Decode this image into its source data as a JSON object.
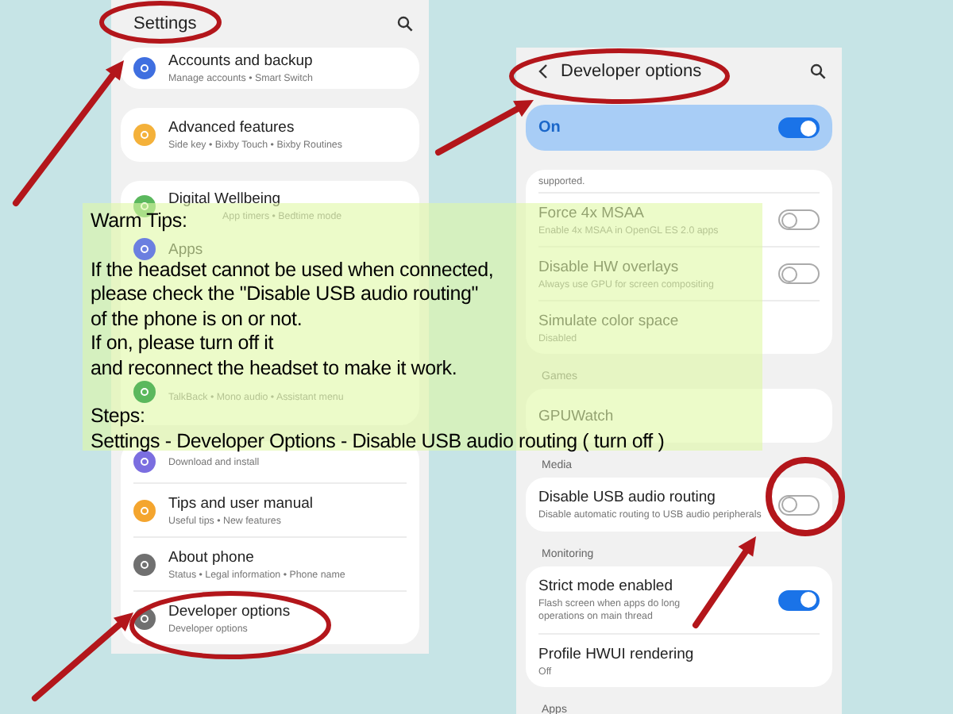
{
  "settings_screen": {
    "title": "Settings",
    "groups": [
      [
        {
          "title": "Accounts and backup",
          "subtitle": "Manage accounts • Smart Switch",
          "color": "#3f6fe0"
        }
      ],
      [
        {
          "title": "Advanced features",
          "subtitle": "Side key • Bixby Touch • Bixby Routines",
          "color": "#f4b13a"
        }
      ],
      [
        {
          "title": "Digital Wellbeing",
          "subtitle": "App timers • Bedtime mode",
          "color": "#5bb85d"
        },
        {
          "title": "Apps",
          "color": "#6b7fe0"
        },
        {
          "subtitle": "TalkBack • Mono audio • Assistant menu",
          "color": "#5bb85d"
        }
      ],
      [
        {
          "subtitle": "Download and install",
          "color": "#7b6ee0"
        },
        {
          "title": "Tips and user manual",
          "subtitle": "Useful tips • New features",
          "color": "#f4a52e"
        },
        {
          "title": "About phone",
          "subtitle": "Status • Legal information • Phone name",
          "color": "#707070"
        },
        {
          "title": "Developer options",
          "subtitle": "Developer options",
          "color": "#707070"
        }
      ]
    ]
  },
  "developer_screen": {
    "title": "Developer options",
    "master_switch": {
      "label": "On",
      "on": true
    },
    "sections": [
      {
        "items": [
          {
            "kind": "note",
            "subtitle": "supported."
          },
          {
            "kind": "toggle",
            "title": "Force 4x MSAA",
            "subtitle": "Enable 4x MSAA in OpenGL ES 2.0 apps",
            "on": false
          },
          {
            "kind": "toggle",
            "title": "Disable HW overlays",
            "subtitle": "Always use GPU for screen compositing",
            "on": false
          },
          {
            "kind": "plain",
            "title": "Simulate color space",
            "subtitle": "Disabled"
          }
        ]
      },
      {
        "heading": "Games",
        "items": [
          {
            "kind": "plain",
            "title": "GPUWatch"
          }
        ]
      },
      {
        "heading": "Media",
        "items": [
          {
            "kind": "toggle",
            "title": "Disable USB audio routing",
            "subtitle": "Disable automatic routing to USB audio peripherals",
            "on": false
          }
        ]
      },
      {
        "heading": "Monitoring",
        "items": [
          {
            "kind": "toggle",
            "title": "Strict mode enabled",
            "subtitle": "Flash screen when apps do long operations on main thread",
            "on": true
          },
          {
            "kind": "plain",
            "title": "Profile HWUI rendering",
            "subtitle": "Off"
          }
        ]
      },
      {
        "heading": "Apps"
      }
    ]
  },
  "tips": {
    "title": "Warm Tips:",
    "lines": [
      "If the headset cannot be used when connected,",
      "please check the \"Disable USB audio routing\"",
      "of the phone is on or not.",
      "If on, please turn off it",
      "and reconnect the headset to make it work."
    ],
    "steps_title": "Steps:",
    "steps": "Settings - Developer Options - Disable USB audio routing ( turn off )"
  }
}
